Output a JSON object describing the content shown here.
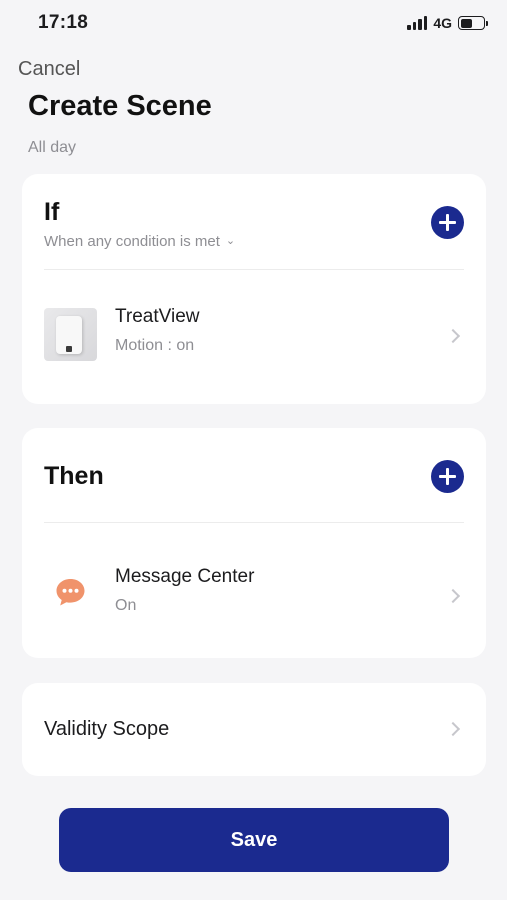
{
  "status_bar": {
    "time": "17:18",
    "network": "4G",
    "battery_level": 0.5
  },
  "header": {
    "cancel_label": "Cancel",
    "title": "Create Scene",
    "subtitle": "All day"
  },
  "if_section": {
    "heading": "If",
    "condition_mode": "When any condition is met",
    "add_icon": "plus-circle-icon",
    "items": [
      {
        "title": "TreatView",
        "subtitle": "Motion : on",
        "icon": "device-thumbnail"
      }
    ]
  },
  "then_section": {
    "heading": "Then",
    "add_icon": "plus-circle-icon",
    "items": [
      {
        "title": "Message Center",
        "subtitle": "On",
        "icon": "chat-bubble-icon"
      }
    ]
  },
  "validity": {
    "label": "Validity Scope"
  },
  "actions": {
    "save_label": "Save"
  },
  "colors": {
    "accent": "#1b2a8f",
    "message_icon": "#f0936b",
    "background": "#f5f5f7"
  }
}
